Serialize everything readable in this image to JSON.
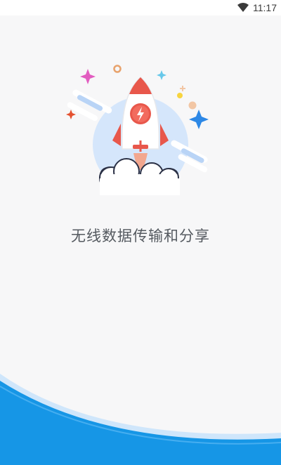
{
  "status_bar": {
    "time": "11:17",
    "icons": [
      "wifi-icon"
    ]
  },
  "splash": {
    "tagline": "无线数据传输和分享",
    "illustration": "rocket-icon"
  },
  "footer": {
    "label": "",
    "colors": {
      "wave_light": "#cfe6fb",
      "wave_main": "#1696e6"
    }
  }
}
